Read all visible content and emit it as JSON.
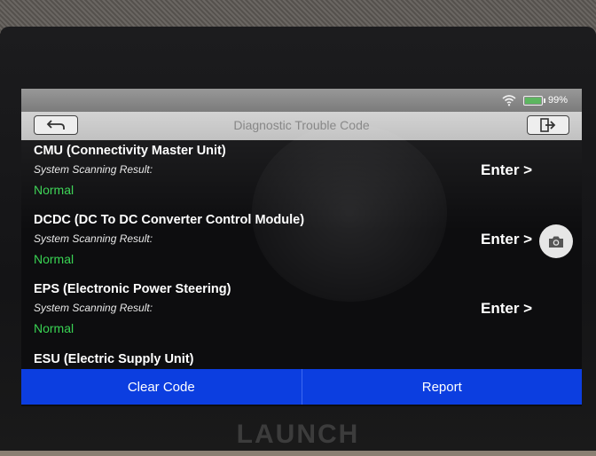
{
  "status_bar": {
    "battery_text": "99%",
    "battery_level": 0.99,
    "wifi_icon": "wifi-icon",
    "battery_icon": "battery-icon"
  },
  "title_bar": {
    "title": "Diagnostic Trouble Code",
    "back_icon": "back-arrow-icon",
    "exit_icon": "exit-icon"
  },
  "modules": [
    {
      "name": "CMU (Connectivity Master Unit)",
      "scan_label": "System Scanning Result:",
      "status": "Normal",
      "enter_label": "Enter >"
    },
    {
      "name": "DCDC (DC To DC Converter Control Module)",
      "scan_label": "System Scanning Result:",
      "status": "Normal",
      "enter_label": "Enter >"
    },
    {
      "name": "EPS (Electronic Power Steering)",
      "scan_label": "System Scanning Result:",
      "status": "Normal",
      "enter_label": "Enter >"
    },
    {
      "name": "ESU (Electric Supply Unit)",
      "scan_label": "",
      "status": "",
      "enter_label": ""
    }
  ],
  "camera_icon": "camera-icon",
  "actions": {
    "clear_code": "Clear Code",
    "report": "Report"
  },
  "brand": "LAUNCH",
  "colors": {
    "status_normal": "#39d353",
    "action_bar": "#0c3ee0",
    "battery": "#4caf50"
  }
}
